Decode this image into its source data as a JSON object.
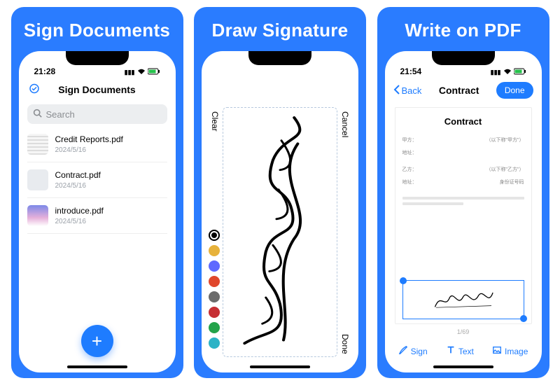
{
  "panels": {
    "p1": {
      "title": "Sign Documents"
    },
    "p2": {
      "title": "Draw Signature"
    },
    "p3": {
      "title": "Write on PDF"
    }
  },
  "status": {
    "time_p1": "21:28",
    "time_p3": "21:54"
  },
  "screen1": {
    "nav_title": "Sign Documents",
    "search_placeholder": "Search",
    "docs": [
      {
        "name": "Credit Reports.pdf",
        "date": "2024/5/16"
      },
      {
        "name": "Contract.pdf",
        "date": "2024/5/16"
      },
      {
        "name": "introduce.pdf",
        "date": "2024/5/16"
      }
    ]
  },
  "screen2": {
    "clear": "Clear",
    "cancel": "Cancel",
    "done": "Done",
    "palette": [
      "#000000",
      "#e7b23b",
      "#5f69ff",
      "#e0472c",
      "#6b6b6b",
      "#c62f33",
      "#23a34a",
      "#2cb3c6"
    ],
    "selected_index": 0
  },
  "screen3": {
    "back": "Back",
    "title": "Contract",
    "done": "Done",
    "page_title": "Contract",
    "pagenum": "1/69",
    "tools": {
      "sign": "Sign",
      "text": "Text",
      "image": "Image"
    }
  }
}
